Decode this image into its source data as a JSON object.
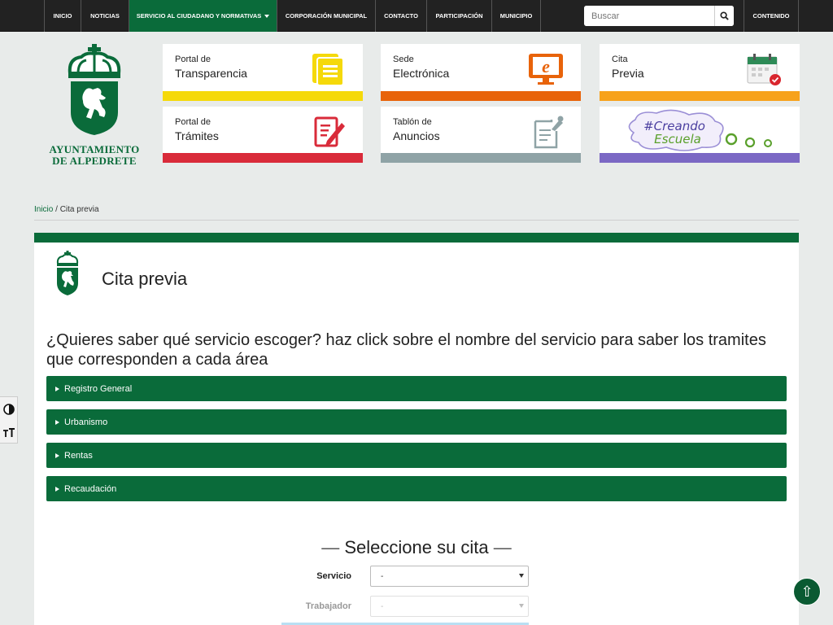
{
  "nav": {
    "items": [
      "INICIO",
      "NOTICIAS",
      "SERVICIO AL CIUDADANO Y NORMATIVAS",
      "CORPORACIÓN MUNICIPAL",
      "CONTACTO",
      "PARTICIPACIÓN",
      "MUNICIPIO"
    ],
    "active_index": 2,
    "search_placeholder": "Buscar",
    "contenido": "CONTENIDO"
  },
  "logo": {
    "line1": "AYUNTAMIENTO",
    "line2": "DE ALPEDRETE"
  },
  "cards": [
    {
      "line1": "Portal de",
      "line2": "Transparencia",
      "color": "#f5d90a",
      "icon": "document-icon"
    },
    {
      "line1": "Sede",
      "line2": "Electrónica",
      "color": "#e8630a",
      "icon": "e-monitor-icon"
    },
    {
      "line1": "Cita",
      "line2": "Previa",
      "color": "#f7a21b",
      "icon": "calendar-icon"
    },
    {
      "line1": "Portal de",
      "line2": "Trámites",
      "color": "#d92b3a",
      "icon": "form-edit-icon"
    },
    {
      "line1": "Tablón de",
      "line2": "Anuncios",
      "color": "#8fa3a6",
      "icon": "notice-board-icon"
    },
    {
      "line1": "#Creando",
      "line2": "Escuela",
      "color": "#7b68c4",
      "icon": "creando-escuela-logo"
    }
  ],
  "breadcrumb": {
    "home": "Inicio",
    "sep": " / ",
    "current": "Cita previa"
  },
  "page": {
    "title": "Cita previa",
    "intro": "¿Quieres saber qué servicio escoger? haz click sobre el nombre del servicio para saber los tramites que corresponden a cada área"
  },
  "accordion": [
    "Registro General",
    "Urbanismo",
    "Rentas",
    "Recaudación"
  ],
  "form": {
    "title": "Seleccione su cita",
    "servicio_label": "Servicio",
    "servicio_value": "-",
    "trabajador_label": "Trabajador",
    "trabajador_value": "-"
  },
  "colors": {
    "brand_green": "#0a6b3a",
    "nav_bg": "#222222"
  }
}
